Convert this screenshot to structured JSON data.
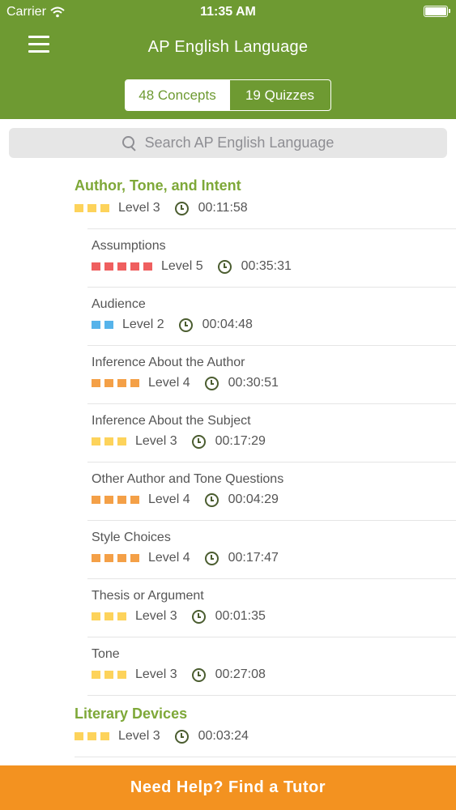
{
  "status_bar": {
    "carrier": "Carrier",
    "time": "11:35 AM"
  },
  "header": {
    "title": "AP English Language",
    "tabs": [
      {
        "label": "48 Concepts",
        "active": true
      },
      {
        "label": "19 Quizzes",
        "active": false
      }
    ]
  },
  "search": {
    "placeholder": "Search AP English Language"
  },
  "colors": {
    "header_green": "#6e9a32",
    "section_title_green": "#7ea838",
    "level_yellow": "#fdd35b",
    "level_orange": "#f4a047",
    "level_red": "#ef5f5f",
    "level_blue": "#56b3ea",
    "tutor_orange": "#f39220"
  },
  "sections": [
    {
      "title": "Author, Tone, and Intent",
      "level_label": "Level 3",
      "level": 3,
      "level_color": "#fdd35b",
      "time": "00:11:58",
      "items": [
        {
          "name": "Assumptions",
          "level_label": "Level 5",
          "level": 5,
          "level_color": "#ef5f5f",
          "time": "00:35:31"
        },
        {
          "name": "Audience",
          "level_label": "Level 2",
          "level": 2,
          "level_color": "#56b3ea",
          "time": "00:04:48"
        },
        {
          "name": "Inference About the Author",
          "level_label": "Level 4",
          "level": 4,
          "level_color": "#f4a047",
          "time": "00:30:51"
        },
        {
          "name": "Inference About the Subject",
          "level_label": "Level 3",
          "level": 3,
          "level_color": "#fdd35b",
          "time": "00:17:29"
        },
        {
          "name": "Other Author and Tone Questions",
          "level_label": "Level 4",
          "level": 4,
          "level_color": "#f4a047",
          "time": "00:04:29"
        },
        {
          "name": "Style Choices",
          "level_label": "Level 4",
          "level": 4,
          "level_color": "#f4a047",
          "time": "00:17:47"
        },
        {
          "name": "Thesis or Argument",
          "level_label": "Level 3",
          "level": 3,
          "level_color": "#fdd35b",
          "time": "00:01:35"
        },
        {
          "name": "Tone",
          "level_label": "Level 3",
          "level": 3,
          "level_color": "#fdd35b",
          "time": "00:27:08"
        }
      ]
    },
    {
      "title": "Literary Devices",
      "level_label": "Level 3",
      "level": 3,
      "level_color": "#fdd35b",
      "time": "00:03:24",
      "items": []
    }
  ],
  "footer": {
    "tutor_label": "Need Help?  Find a Tutor"
  }
}
